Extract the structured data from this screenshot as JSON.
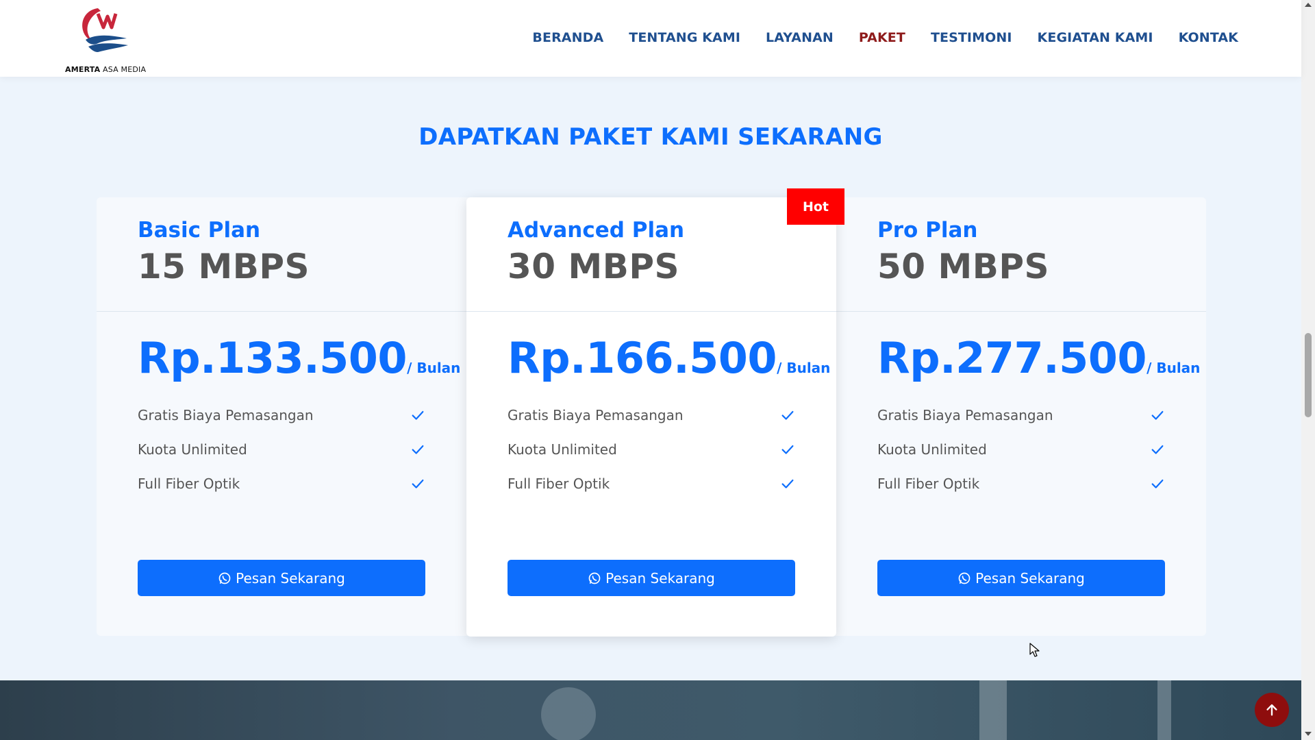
{
  "header": {
    "logo_text_bold": "AMERTA",
    "logo_text": " ASA MEDIA",
    "nav": [
      {
        "label": "BERANDA",
        "active": false
      },
      {
        "label": "TENTANG KAMI",
        "active": false
      },
      {
        "label": "LAYANAN",
        "active": false
      },
      {
        "label": "PAKET",
        "active": true
      },
      {
        "label": "TESTIMONI",
        "active": false
      },
      {
        "label": "KEGIATAN KAMI",
        "active": false
      },
      {
        "label": "KONTAK",
        "active": false
      }
    ]
  },
  "section": {
    "title": "DAPATKAN PAKET KAMI SEKARANG",
    "badge": "Hot"
  },
  "plans": [
    {
      "name": "Basic Plan",
      "speed": "15 MBPS",
      "price": "Rp.133.500",
      "per": "/ Bulan",
      "features": [
        "Gratis Biaya Pemasangan",
        "Kuota Unlimited",
        "Full Fiber Optik"
      ],
      "button": "Pesan Sekarang"
    },
    {
      "name": "Advanced Plan",
      "speed": "30 MBPS",
      "price": "Rp.166.500",
      "per": "/ Bulan",
      "features": [
        "Gratis Biaya Pemasangan",
        "Kuota Unlimited",
        "Full Fiber Optik"
      ],
      "button": "Pesan Sekarang"
    },
    {
      "name": "Pro Plan",
      "speed": "50 MBPS",
      "price": "Rp.277.500",
      "per": "/ Bulan",
      "features": [
        "Gratis Biaya Pemasangan",
        "Kuota Unlimited",
        "Full Fiber Optik"
      ],
      "button": "Pesan Sekarang"
    }
  ],
  "icons": {
    "feature": "check-icon",
    "button": "whatsapp-icon",
    "scroll_top": "arrow-up-icon"
  },
  "colors": {
    "primary": "#0d6efd",
    "nav": "#1f4f8f",
    "nav_active": "#8e1b1b",
    "badge": "#ff0000",
    "scroll_top": "#8e0d0d"
  }
}
